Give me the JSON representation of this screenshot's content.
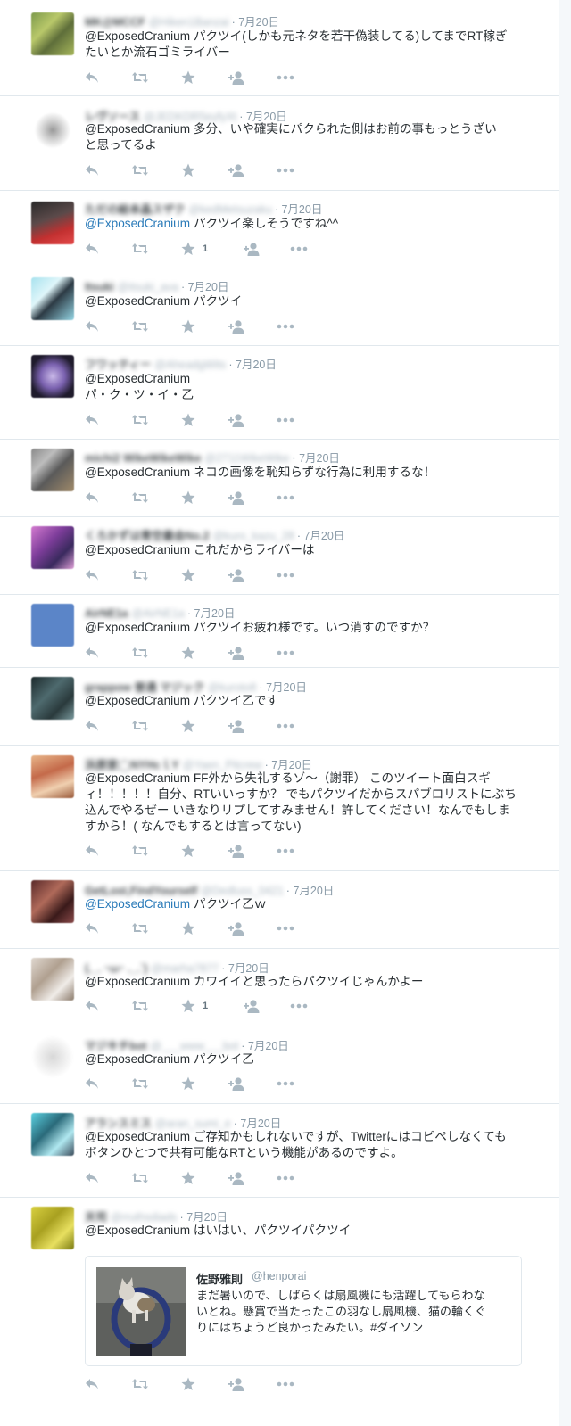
{
  "tweets": [
    {
      "name": "MK@MCCF",
      "handle": "@Hiken1Banzai",
      "date": "7月20日",
      "mention": "@ExposedCranium",
      "text": " パクツイ(しかも元ネタを若干偽装してる)してまでRT稼ぎ\nたいとか流石ゴミライバー",
      "like_count": ""
    },
    {
      "name": "レヴソース",
      "handle": "@JEDKDR5eyfyXt",
      "date": "7月20日",
      "mention": "@ExposedCranium",
      "text": " 多分、いや確実にパクられた側はお前の事もっとうざい\nと思ってるよ",
      "like_count": ""
    },
    {
      "name": "ただの絵本晶スザク",
      "handle": "@kedMetsuzaku",
      "date": "7月20日",
      "mention": "@ExposedCranium",
      "text": " パクツイ楽しそうですね^^",
      "like_count": "1"
    },
    {
      "name": "Itsuki",
      "handle": "@itsuki_ava",
      "date": "7月20日",
      "mention": "@ExposedCranium",
      "text": " パクツイ",
      "like_count": ""
    },
    {
      "name": "フワッティー",
      "handle": "@AheadgWits",
      "date": "7月20日",
      "mention": "@ExposedCranium",
      "text": "\nパ・ク・ツ・イ・乙",
      "like_count": ""
    },
    {
      "name": "michi2 WikeWikeWike",
      "handle": "@2711WikeWike",
      "date": "7月20日",
      "mention": "@ExposedCranium",
      "text": " ネコの画像を恥知らずな行為に利用するな！",
      "like_count": ""
    },
    {
      "name": "くろかずは青空最会No.2",
      "handle": "@kuro_kazu_28",
      "date": "7月20日",
      "mention": "@ExposedCranium",
      "text": " これだからライバーは",
      "like_count": ""
    },
    {
      "name": "AirNE1a",
      "handle": "@AirNE1a",
      "date": "7月20日",
      "mention": "@ExposedCranium",
      "text": " パクツイお疲れ様です。いつ消すのですか？",
      "like_count": ""
    },
    {
      "name": "grappow 普通 マジック",
      "handle": "@kuroto8",
      "date": "7月20日",
      "mention": "@ExposedCranium",
      "text": " パクツイ乙です",
      "like_count": ""
    },
    {
      "name": "浜原家◯NYHcｌY",
      "handle": "@Yaen_Pitcrew",
      "date": "7月20日",
      "mention": "@ExposedCranium",
      "text": " FF外から失礼するゾ〜（謝罪） このツイート面白スギ\nィ！！！！！自分、RTいいっすか？ でもパクツイだからスパブロリストにぶち\n込んでやるぜー いきなりリプしてすみません！許してください！なんでもしま\nすから！( なんでもするとは言ってない)",
      "like_count": ""
    },
    {
      "name": "GetLost,FindYourself",
      "handle": "@Dedluss_0421",
      "date": "7月20日",
      "mention": "@ExposedCranium",
      "text": " パクツイ乙ｗ",
      "like_count": ""
    },
    {
      "name": "(._. ･ω･ ._.`)",
      "handle": "@marha7877",
      "date": "7月20日",
      "mention": "@ExposedCranium",
      "text": " カワイイと思ったらパクツイじゃんかよー",
      "like_count": "1"
    },
    {
      "name": "マジキチbot",
      "handle": "@___www___bot",
      "date": "7月20日",
      "mention": "@ExposedCranium",
      "text": " パクツイ乙",
      "like_count": ""
    },
    {
      "name": "アランスミス",
      "handle": "@aran_sumi_e",
      "date": "7月20日",
      "mention": "@ExposedCranium",
      "text": " ご存知かもしれないですが、Twitterにはコピペしなくても\nボタンひとつで共有可能なRTという機能があるのですよ。",
      "like_count": ""
    },
    {
      "name": "天司",
      "handle": "@rruthsdiads",
      "date": "7月20日",
      "mention": "@ExposedCranium",
      "text": " はいはい、パクツイパクツイ",
      "like_count": ""
    }
  ],
  "quoted_tweet": {
    "name": "佐野雅則",
    "handle": "@henporai",
    "text": "まだ暑いので、しばらくは扇風機にも活躍してもらわな\nいとね。懸賞で当たったこの羽なし扇風機、猫の輪くぐ\nりにはちょうど良かったみたい。#ダイソン"
  },
  "icons": [
    "reply-icon",
    "retweet-icon",
    "favorite-icon",
    "follow-icon",
    "more-icon"
  ],
  "colors": {
    "link": "#2b7bb9",
    "meta": "#8899a6",
    "icon": "#aab8c2",
    "text": "#292f33",
    "border": "#e1e8ed"
  }
}
